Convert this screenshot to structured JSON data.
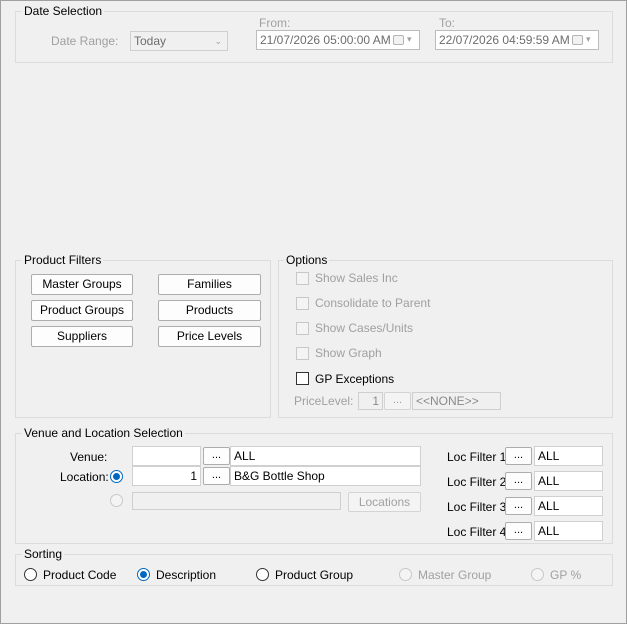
{
  "date_selection": {
    "legend": "Date Selection",
    "date_range_label": "Date Range:",
    "date_range_value": "Today",
    "from_label": "From:",
    "from_value": "21/07/2026 05:00:00 AM",
    "to_label": "To:",
    "to_value": "22/07/2026 04:59:59 AM"
  },
  "product_filters": {
    "legend": "Product Filters",
    "master_groups": "Master Groups",
    "families": "Families",
    "product_groups": "Product Groups",
    "products": "Products",
    "suppliers": "Suppliers",
    "price_levels": "Price Levels"
  },
  "options": {
    "legend": "Options",
    "show_sales_inc": "Show Sales Inc",
    "consolidate_to_parent": "Consolidate to Parent",
    "show_cases_units": "Show Cases/Units",
    "show_graph": "Show Graph",
    "gp_exceptions": "GP Exceptions",
    "price_level_label": "PriceLevel:",
    "price_level_num": "1",
    "price_level_value": "<<NONE>>"
  },
  "venue_location": {
    "legend": "Venue and Location Selection",
    "venue_label": "Venue:",
    "venue_code": "",
    "venue_value": "ALL",
    "location_label": "Location:",
    "location_code": "1",
    "location_value": "B&G Bottle Shop",
    "locations_button": "Locations",
    "dots": "...",
    "loc_filters": [
      {
        "label": "Loc Filter 1:",
        "value": "ALL"
      },
      {
        "label": "Loc Filter 2:",
        "value": "ALL"
      },
      {
        "label": "Loc Filter 3:",
        "value": "ALL"
      },
      {
        "label": "Loc Filter 4:",
        "value": "ALL"
      }
    ]
  },
  "sorting": {
    "legend": "Sorting",
    "product_code": "Product Code",
    "description": "Description",
    "product_group": "Product Group",
    "master_group": "Master Group",
    "gp_percent": "GP %",
    "selected": "Description"
  },
  "icons": {
    "calendar": "calendar-icon",
    "dropdown": "chevron-down-icon"
  }
}
